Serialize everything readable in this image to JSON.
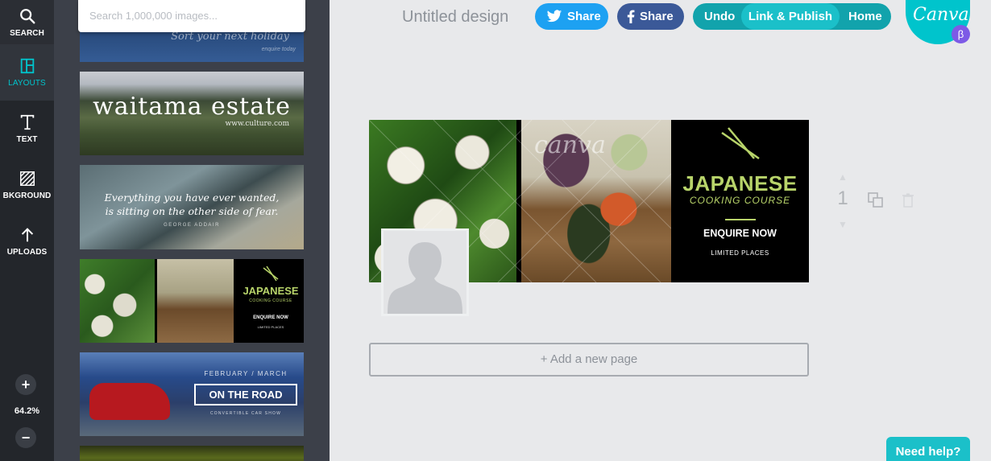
{
  "toolbar": {
    "search_label": "SEARCH",
    "layouts_label": "LAYOUTS",
    "text_label": "TEXT",
    "background_label": "BKGROUND",
    "uploads_label": "UPLOADS",
    "zoom_in": "+",
    "zoom_level": "64.2%",
    "zoom_out": "−"
  },
  "panel": {
    "search_placeholder": "Search 1,000,000 images...",
    "thumbs": {
      "holiday": {
        "line1": "Sort your next holiday",
        "line2": "enquire today"
      },
      "estate": {
        "title": "waitama estate",
        "url": "www.culture.com"
      },
      "quote": {
        "line1": "Everything you have ever wanted,",
        "line2": "is sitting on the other side of fear.",
        "author": "GEORGE ADDAIR"
      },
      "japan": {
        "title": "JAPANESE",
        "subtitle": "COOKING COURSE",
        "cta": "ENQUIRE NOW",
        "note": "LIMITED PLACES"
      },
      "road": {
        "dates": "FEBRUARY / MARCH",
        "title": "ON THE ROAD",
        "event": "CONVERTIBLE CAR SHOW"
      }
    }
  },
  "header": {
    "title": "Untitled design",
    "twitter_share": "Share",
    "facebook_share": "Share",
    "undo": "Undo",
    "link_publish": "Link & Publish",
    "home": "Home",
    "logo_text": "Canva",
    "beta": "β"
  },
  "design": {
    "watermark": "canva",
    "title": "JAPANESE",
    "subtitle": "COOKING COURSE",
    "cta": "ENQUIRE NOW",
    "note": "LIMITED PLACES"
  },
  "page_controls": {
    "page_number": "1"
  },
  "add_page": "+ Add a new page",
  "help": "Need help?",
  "colors": {
    "accent": "#00c4cc",
    "twitter": "#1da1f2",
    "facebook": "#3b5998",
    "sidebar": "#23262b",
    "panel": "#3c4049",
    "design_green": "#b8d46a"
  }
}
